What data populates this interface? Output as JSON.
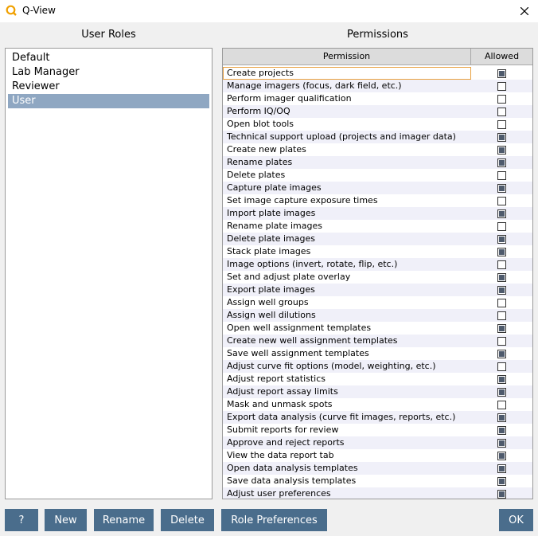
{
  "window": {
    "title": "Q-View",
    "accent": "#f0a000"
  },
  "roles": {
    "title": "User Roles",
    "items": [
      "Default",
      "Lab Manager",
      "Reviewer",
      "User"
    ],
    "selected_index": 3
  },
  "permissions": {
    "title": "Permissions",
    "col_permission": "Permission",
    "col_allowed": "Allowed",
    "rows": [
      {
        "label": "Create projects",
        "allowed": true
      },
      {
        "label": "Manage imagers (focus, dark field, etc.)",
        "allowed": false
      },
      {
        "label": "Perform imager qualification",
        "allowed": false
      },
      {
        "label": "Perform IQ/OQ",
        "allowed": false
      },
      {
        "label": "Open blot tools",
        "allowed": false
      },
      {
        "label": "Technical support upload (projects and imager data)",
        "allowed": true
      },
      {
        "label": "Create new plates",
        "allowed": true
      },
      {
        "label": "Rename plates",
        "allowed": true
      },
      {
        "label": "Delete plates",
        "allowed": false
      },
      {
        "label": "Capture plate images",
        "allowed": true
      },
      {
        "label": "Set image capture exposure times",
        "allowed": false
      },
      {
        "label": "Import plate images",
        "allowed": true
      },
      {
        "label": "Rename plate images",
        "allowed": false
      },
      {
        "label": "Delete plate images",
        "allowed": true
      },
      {
        "label": "Stack plate images",
        "allowed": true
      },
      {
        "label": "Image options (invert, rotate, flip, etc.)",
        "allowed": false
      },
      {
        "label": "Set and adjust plate overlay",
        "allowed": true
      },
      {
        "label": "Export plate images",
        "allowed": true
      },
      {
        "label": "Assign well groups",
        "allowed": false
      },
      {
        "label": "Assign well dilutions",
        "allowed": false
      },
      {
        "label": "Open well assignment templates",
        "allowed": true
      },
      {
        "label": "Create new well assignment templates",
        "allowed": false
      },
      {
        "label": "Save well assignment templates",
        "allowed": true
      },
      {
        "label": "Adjust curve fit options (model, weighting, etc.)",
        "allowed": false
      },
      {
        "label": "Adjust report statistics",
        "allowed": true
      },
      {
        "label": "Adjust report assay limits",
        "allowed": true
      },
      {
        "label": "Mask and unmask spots",
        "allowed": false
      },
      {
        "label": "Export data analysis (curve fit images, reports, etc.)",
        "allowed": true
      },
      {
        "label": "Submit reports for review",
        "allowed": true
      },
      {
        "label": "Approve and reject reports",
        "allowed": true
      },
      {
        "label": "View the data report tab",
        "allowed": true
      },
      {
        "label": "Open data analysis templates",
        "allowed": true
      },
      {
        "label": "Save data analysis templates",
        "allowed": true
      },
      {
        "label": "Adjust user preferences",
        "allowed": true
      }
    ]
  },
  "buttons": {
    "help": "?",
    "new": "New",
    "rename": "Rename",
    "delete": "Delete",
    "role_prefs": "Role Preferences",
    "ok": "OK"
  }
}
